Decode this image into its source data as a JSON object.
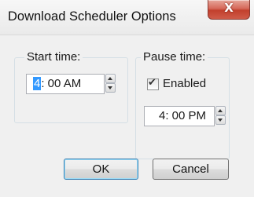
{
  "window": {
    "title": "Download Scheduler Options",
    "close_glyph": "X"
  },
  "start_time": {
    "group_label": "Start time:",
    "hour": "4",
    "rest": ": 00 AM",
    "spinner_icons": [
      "spin-up-icon",
      "spin-down-icon"
    ]
  },
  "pause_time": {
    "group_label": "Pause time:",
    "enabled_label": "Enabled",
    "enabled_checked": true,
    "check_glyph": "✔",
    "value": "4: 00 PM",
    "spinner_icons": [
      "spin-up-icon",
      "spin-down-icon"
    ]
  },
  "buttons": {
    "ok_label": "OK",
    "cancel_label": "Cancel"
  },
  "colors": {
    "selection": "#3399ff",
    "close_button": "#c2402d",
    "default_button_border": "#3c7fb1"
  }
}
